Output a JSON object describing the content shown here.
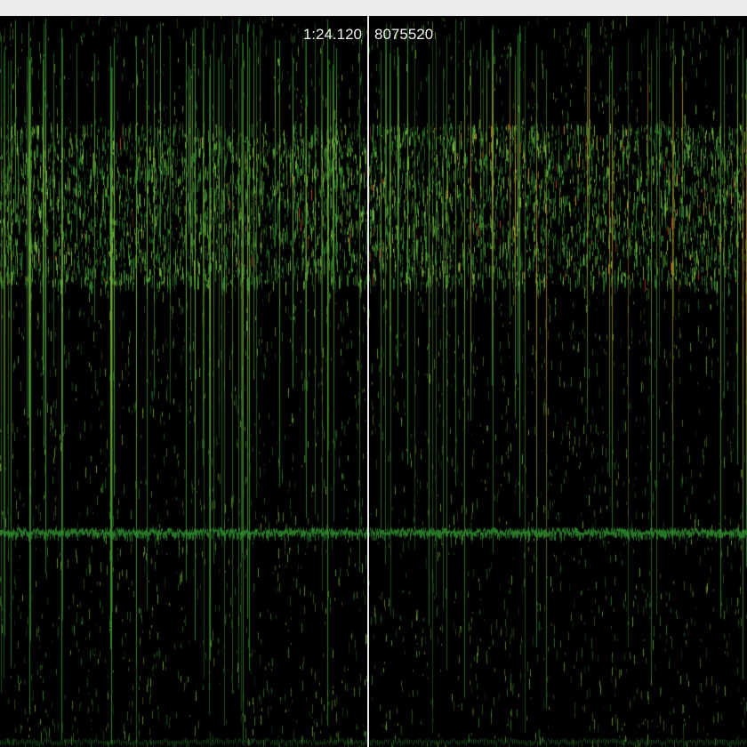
{
  "readout": {
    "time": "1:24.120",
    "sample": "8075520"
  },
  "colors": {
    "background": "#000000",
    "window_strip": "#ececec",
    "playhead": "#e9e9e9",
    "readout_text": "#f2f2f2",
    "spectrum_low": "#2e8b2e",
    "spectrum_mid": "#7fbf3f",
    "spectrum_high": "#e0a030",
    "spectrum_peak": "#d04020"
  }
}
